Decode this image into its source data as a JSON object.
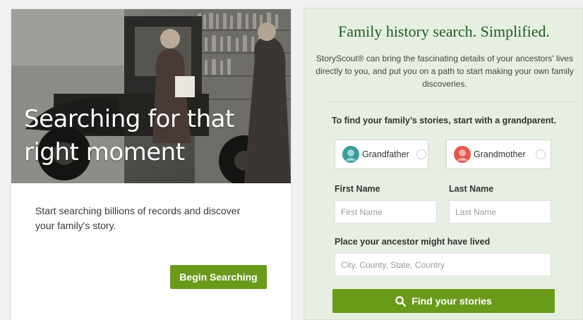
{
  "hero": {
    "title": "Searching for that right moment",
    "description": "Start searching billions of records and discover your family's story.",
    "begin_button": "Begin Searching"
  },
  "search_panel": {
    "title": "Family history search. Simplified.",
    "description": "StoryScout® can bring the fascinating details of your ancestors' lives directly to you, and put you on a path to start making your own family discoveries.",
    "prompt": "To find your family’s stories, start with a grandparent.",
    "grandparents": [
      {
        "label": "Grandfather",
        "icon": "grandfather-avatar-icon",
        "color": "#3a9d9a"
      },
      {
        "label": "Grandmother",
        "icon": "grandmother-avatar-icon",
        "color": "#e8554d"
      }
    ],
    "first_name": {
      "label": "First Name",
      "placeholder": "First Name",
      "value": ""
    },
    "last_name": {
      "label": "Last Name",
      "placeholder": "Last Name",
      "value": ""
    },
    "place": {
      "label": "Place your ancestor might have lived",
      "placeholder": "City, County, State, Country",
      "value": ""
    },
    "find_button": "Find your stories",
    "find_icon": "search-icon"
  },
  "colors": {
    "accent_green": "#6a9a1a",
    "panel_background": "#e6efe2",
    "title_green": "#1f5a25"
  }
}
